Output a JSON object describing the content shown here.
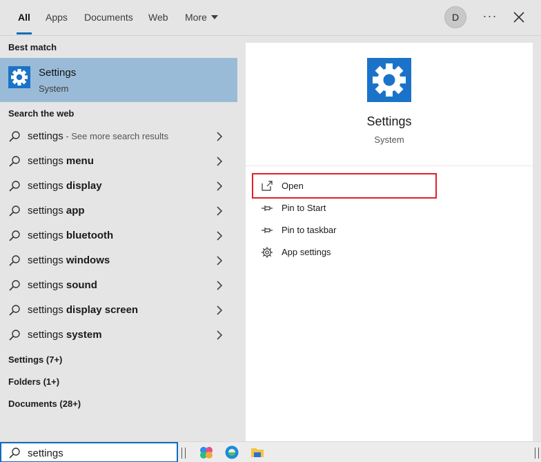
{
  "tabs": [
    "All",
    "Apps",
    "Documents",
    "Web",
    "More"
  ],
  "avatar_initial": "D",
  "more_options": "···",
  "left": {
    "best_match_heading": "Best match",
    "best_match": {
      "title": "Settings",
      "subtitle": "System"
    },
    "search_web_heading": "Search the web",
    "web_results": [
      {
        "prefix": "settings",
        "bold": "",
        "suffix": " - See more search results"
      },
      {
        "prefix": "settings ",
        "bold": "menu",
        "suffix": ""
      },
      {
        "prefix": "settings ",
        "bold": "display",
        "suffix": ""
      },
      {
        "prefix": "settings ",
        "bold": "app",
        "suffix": ""
      },
      {
        "prefix": "settings ",
        "bold": "bluetooth",
        "suffix": ""
      },
      {
        "prefix": "settings ",
        "bold": "windows",
        "suffix": ""
      },
      {
        "prefix": "settings ",
        "bold": "sound",
        "suffix": ""
      },
      {
        "prefix": "settings ",
        "bold": "display screen",
        "suffix": ""
      },
      {
        "prefix": "settings ",
        "bold": "system",
        "suffix": ""
      }
    ],
    "categories": [
      "Settings (7+)",
      "Folders (1+)",
      "Documents (28+)"
    ]
  },
  "detail": {
    "title": "Settings",
    "subtitle": "System",
    "actions": [
      {
        "label": "Open",
        "icon": "open-icon"
      },
      {
        "label": "Pin to Start",
        "icon": "pin-icon"
      },
      {
        "label": "Pin to taskbar",
        "icon": "pin-icon"
      },
      {
        "label": "App settings",
        "icon": "gear-icon"
      }
    ]
  },
  "taskbar": {
    "search_value": "settings",
    "items": [
      "copilot-icon",
      "edge-icon",
      "file-explorer-icon"
    ]
  },
  "colors": {
    "accent": "#0f6cbd",
    "selection": "#99bbd7",
    "settings_icon_bg": "#1a73c8",
    "highlight_border": "#e01f2b"
  }
}
